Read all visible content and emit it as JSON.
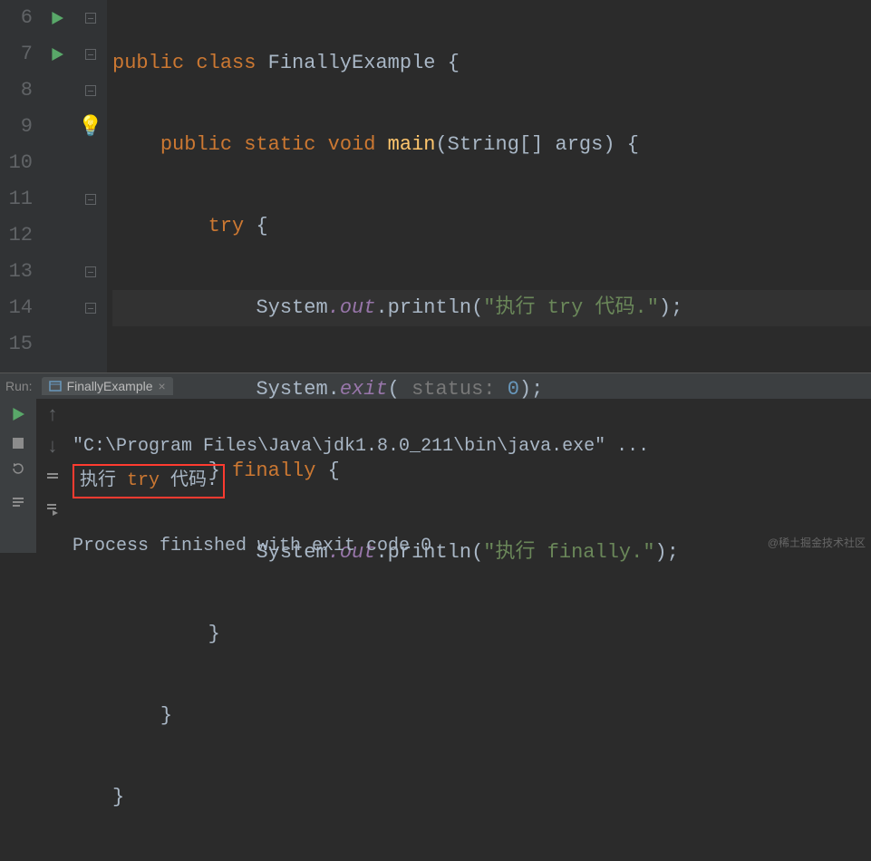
{
  "editor": {
    "lines": [
      "6",
      "7",
      "8",
      "9",
      "10",
      "11",
      "12",
      "13",
      "14",
      "15"
    ],
    "code": {
      "l6": {
        "kw1": "public",
        "kw2": "class",
        "name": "FinallyExample",
        "brace": "{"
      },
      "l7": {
        "kw1": "public",
        "kw2": "static",
        "kw3": "void",
        "method": "main",
        "params": "(String[] args)",
        "brace": "{"
      },
      "l8": {
        "kw": "try",
        "brace": "{"
      },
      "l9": {
        "obj": "System",
        "field": ".out",
        "dot": ".",
        "method": "println",
        "open": "(",
        "str": "\"执行 try 代码.\"",
        "close": ");"
      },
      "l10": {
        "obj": "System",
        "dot1": ".",
        "method": "exit",
        "open": "(",
        "hint": " status: ",
        "num": "0",
        "close": ");"
      },
      "l11": {
        "close": "}",
        "kw": "finally",
        "brace": "{"
      },
      "l12": {
        "obj": "System",
        "field": ".out",
        "dot": ".",
        "method": "println",
        "open": "(",
        "str": "\"执行 finally.\"",
        "close": ");"
      },
      "l13": {
        "close": "}"
      },
      "l14": {
        "close": "}"
      },
      "l15": {
        "close": "}"
      }
    }
  },
  "run": {
    "label": "Run:",
    "tab": "FinallyExample",
    "close": "×",
    "console": {
      "cmd": "\"C:\\Program Files\\Java\\jdk1.8.0_211\\bin\\java.exe\" ...",
      "out_pre": "执行 ",
      "out_kw": "try",
      "out_post": " 代码.",
      "exit": "Process finished with exit code 0"
    }
  },
  "watermark": "@稀土掘金技术社区"
}
